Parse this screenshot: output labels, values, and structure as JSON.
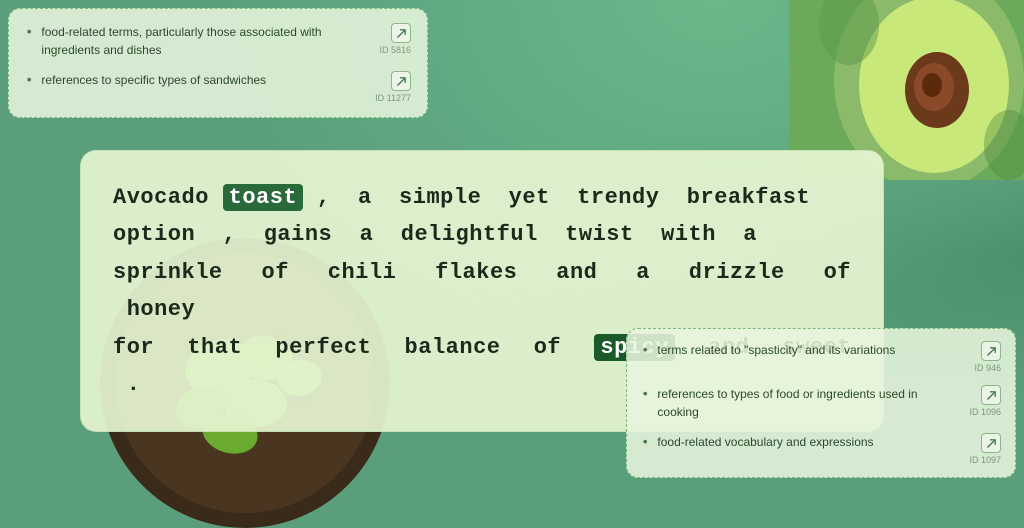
{
  "background": {
    "color": "#5a9e7c"
  },
  "panel_top_left": {
    "items": [
      {
        "text": "food-related terms, particularly those associated with ingredients and dishes",
        "id": "ID 5816",
        "icon": "external-link-icon"
      },
      {
        "text": "references to specific types of sandwiches",
        "id": "ID 11277",
        "icon": "external-link-icon"
      }
    ]
  },
  "main_text": {
    "words": [
      {
        "text": "Avocado",
        "highlight": false
      },
      {
        "text": "toast",
        "highlight": "toast"
      },
      {
        "text": ",",
        "highlight": false
      },
      {
        "text": "a",
        "highlight": false
      },
      {
        "text": "simple",
        "highlight": false
      },
      {
        "text": "yet",
        "highlight": false
      },
      {
        "text": "trendy",
        "highlight": false
      },
      {
        "text": "breakfast",
        "highlight": false
      },
      {
        "text": "option",
        "highlight": false
      },
      {
        "text": ",",
        "highlight": false
      },
      {
        "text": "gains",
        "highlight": false
      },
      {
        "text": "a",
        "highlight": false
      },
      {
        "text": "delightful",
        "highlight": false
      },
      {
        "text": "twist",
        "highlight": false
      },
      {
        "text": "with",
        "highlight": false
      },
      {
        "text": "a",
        "highlight": false
      },
      {
        "text": "sprinkle",
        "highlight": false
      },
      {
        "text": "of",
        "highlight": false
      },
      {
        "text": "chili",
        "highlight": false
      },
      {
        "text": "flakes",
        "highlight": false
      },
      {
        "text": "and",
        "highlight": false
      },
      {
        "text": "a",
        "highlight": false
      },
      {
        "text": "drizzle",
        "highlight": false
      },
      {
        "text": "of",
        "highlight": false
      },
      {
        "text": "honey",
        "highlight": false
      },
      {
        "text": "for",
        "highlight": false
      },
      {
        "text": "that",
        "highlight": false
      },
      {
        "text": "perfect",
        "highlight": false
      },
      {
        "text": "balance",
        "highlight": false
      },
      {
        "text": "of",
        "highlight": false
      },
      {
        "text": "spicy",
        "highlight": "spicy"
      },
      {
        "text": "and",
        "highlight": false
      },
      {
        "text": "sweet",
        "highlight": false
      },
      {
        "text": ".",
        "highlight": false
      }
    ],
    "full_text": "Avocado toast , a simple yet trendy breakfast option , gains a delightful twist with a sprinkle of chili flakes and a drizzle of honey for that perfect balance of spicy and sweet ."
  },
  "panel_bottom_right": {
    "items": [
      {
        "text": "terms related to \"spasticity\" and its variations",
        "id": "ID 946",
        "icon": "external-link-icon"
      },
      {
        "text": "references to types of food or ingredients used in cooking",
        "id": "ID 1096",
        "icon": "external-link-icon"
      },
      {
        "text": "food-related vocabulary and expressions",
        "id": "ID 1097",
        "icon": "external-link-icon"
      }
    ]
  },
  "icons": {
    "external_link": "↗",
    "bullet": "•"
  }
}
